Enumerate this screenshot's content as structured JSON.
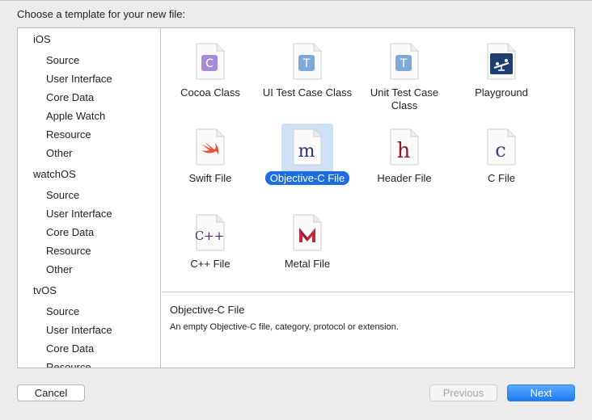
{
  "prompt": "Choose a template for your new file:",
  "sidebar": {
    "groups": [
      {
        "label": "iOS",
        "items": [
          "Source",
          "User Interface",
          "Core Data",
          "Apple Watch",
          "Resource",
          "Other"
        ]
      },
      {
        "label": "watchOS",
        "items": [
          "Source",
          "User Interface",
          "Core Data",
          "Resource",
          "Other"
        ]
      },
      {
        "label": "tvOS",
        "items": [
          "Source",
          "User Interface",
          "Core Data",
          "Resource"
        ]
      }
    ]
  },
  "templates": [
    {
      "label": "Cocoa Class",
      "icon": "cocoa-class-icon",
      "glyph": "C",
      "color": "#9b7fd0"
    },
    {
      "label": "UI Test Case Class",
      "icon": "ui-test-case-class-icon",
      "glyph": "T",
      "color": "#7aa7d8"
    },
    {
      "label": "Unit Test Case Class",
      "icon": "unit-test-case-class-icon",
      "glyph": "T",
      "color": "#7aa7d8"
    },
    {
      "label": "Playground",
      "icon": "playground-icon",
      "glyph": "",
      "color": "#1f3f73"
    },
    {
      "label": "Swift File",
      "icon": "swift-file-icon",
      "glyph": "",
      "color": "#f05138"
    },
    {
      "label": "Objective-C File",
      "icon": "objective-c-file-icon",
      "glyph": "m",
      "color": "#3a2e6e",
      "selected": true
    },
    {
      "label": "Header File",
      "icon": "header-file-icon",
      "glyph": "h",
      "color": "#8b1a2b"
    },
    {
      "label": "C File",
      "icon": "c-file-icon",
      "glyph": "c",
      "color": "#4b3a8c"
    },
    {
      "label": "C++ File",
      "icon": "cpp-file-icon",
      "glyph": "C++",
      "color": "#4b2a6e"
    },
    {
      "label": "Metal File",
      "icon": "metal-file-icon",
      "glyph": "",
      "color": "#c8283a"
    }
  ],
  "description": {
    "title": "Objective-C File",
    "text": "An empty Objective-C file, category, protocol or extension."
  },
  "buttons": {
    "cancel": "Cancel",
    "previous": "Previous",
    "next": "Next"
  }
}
